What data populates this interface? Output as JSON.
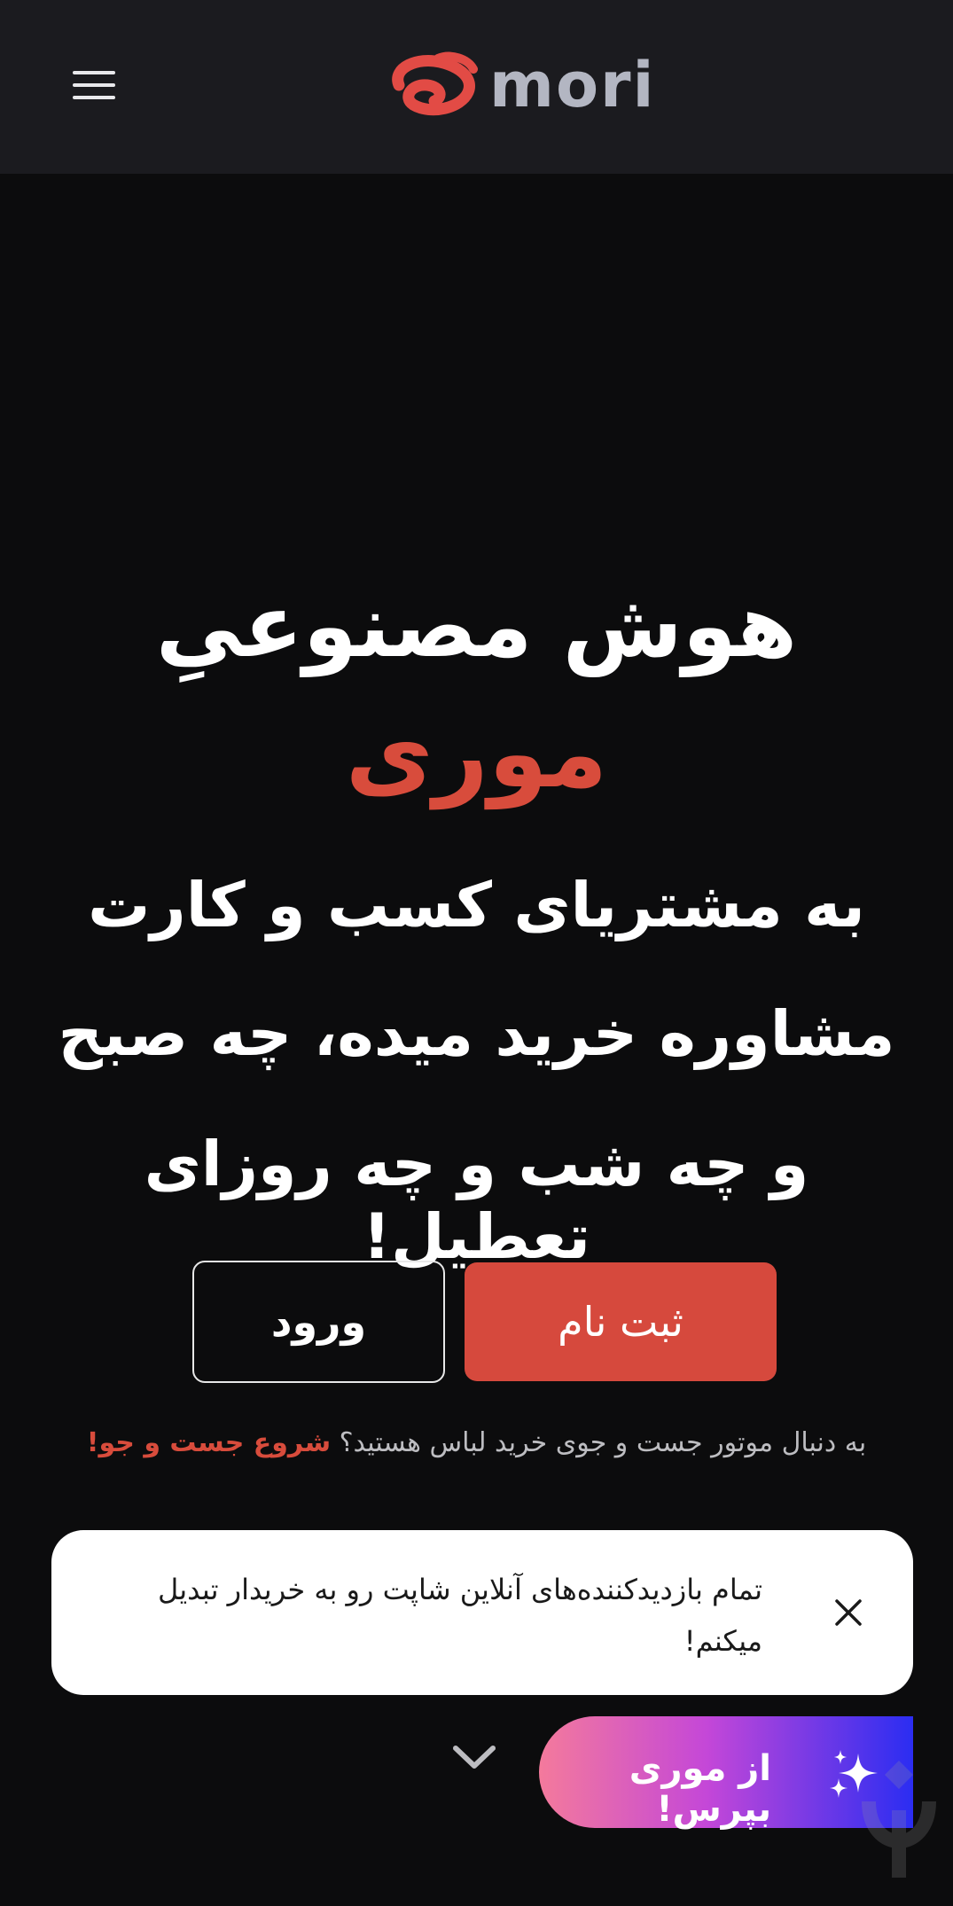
{
  "header": {
    "menu_icon": "hamburger-menu-icon",
    "logo_text": "mori"
  },
  "hero": {
    "title_line1": "هوش مصنوعیِ",
    "title_line2": "موری",
    "subtitle_line1": "به مشتریای کسب و کارت",
    "subtitle_line2": "مشاوره خرید میده، چه صبح",
    "subtitle_line3": "و چه شب و چه روزای تعطیل!",
    "signup_label": "ثبت نام",
    "login_label": "ورود",
    "promo_text": "به دنبال موتور جست و جوی خرید لباس هستید؟",
    "promo_link": "شروع جست و جو!"
  },
  "toast": {
    "text": "تمام بازدیدکننده‌های آنلاین شاپت رو به خریدار تبدیل میکنم!",
    "close_icon": "close-icon"
  },
  "chat": {
    "label": "از موری بپرس!",
    "icon": "sparkle-icon",
    "collapse_icon": "chevron-down-icon"
  },
  "colors": {
    "accent": "#d84c3c",
    "header_bg": "#1b1b1f",
    "page_bg": "#0c0c0d",
    "logo_gray": "#b3b6c2"
  }
}
